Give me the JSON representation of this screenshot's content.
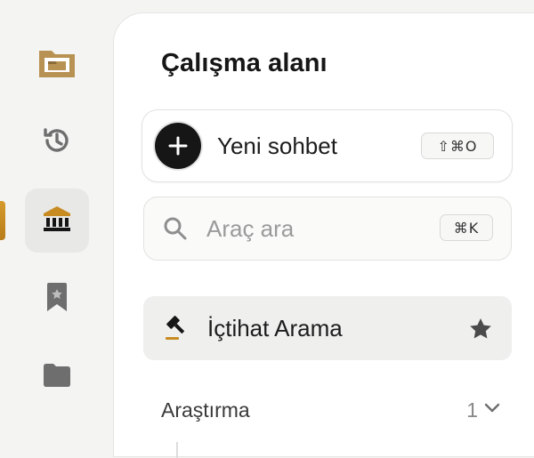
{
  "sidebar": {
    "items": [
      {
        "name": "folder-logo",
        "icon": "folder-logo-icon"
      },
      {
        "name": "history",
        "icon": "history-icon"
      },
      {
        "name": "institution",
        "icon": "bank-icon",
        "active": true
      },
      {
        "name": "saved",
        "icon": "bookmark-star-icon"
      },
      {
        "name": "folders",
        "icon": "folder-icon"
      }
    ],
    "accent": "#c88b22"
  },
  "panel": {
    "title": "Çalışma alanı",
    "new_chat": {
      "label": "Yeni sohbet",
      "shortcut": "⇧⌘O"
    },
    "search": {
      "placeholder": "Araç ara",
      "shortcut": "⌘K"
    },
    "tool": {
      "label": "İçtihat Arama",
      "starred": true
    },
    "section": {
      "label": "Araştırma",
      "count": "1"
    }
  }
}
